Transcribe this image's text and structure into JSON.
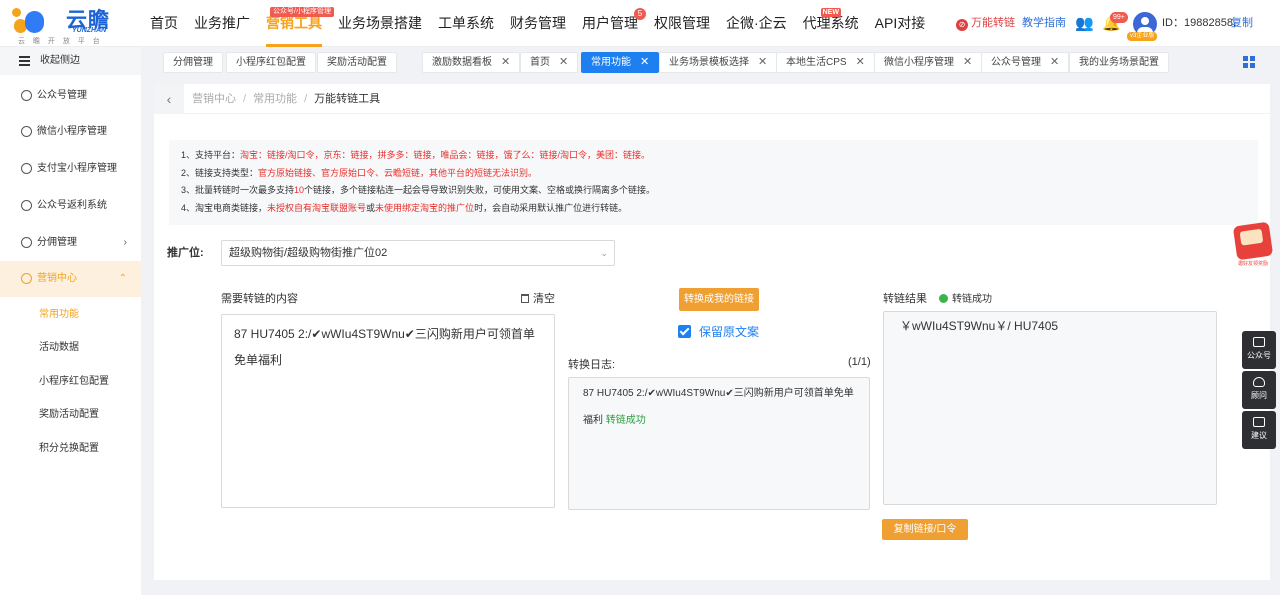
{
  "brand": {
    "name": "云瞻",
    "name_en": "YUNZHAN",
    "slogan": "云 瞻 开 放 平 台"
  },
  "nav": {
    "items": [
      {
        "label": "首页"
      },
      {
        "label": "业务推广"
      },
      {
        "label": "营销工具",
        "tag": "公众号/小程序管理",
        "active": true
      },
      {
        "label": "业务场景搭建"
      },
      {
        "label": "工单系统"
      },
      {
        "label": "财务管理"
      },
      {
        "label": "用户管理",
        "badge": "5"
      },
      {
        "label": "权限管理"
      },
      {
        "label": "企微·企云"
      },
      {
        "label": "代理系统",
        "new_tag": "NEW"
      },
      {
        "label": "API对接"
      }
    ]
  },
  "topright": {
    "shortlink_label": "万能转链",
    "guide_label": "教学指南",
    "bell_badge": "99+",
    "avatar_tag": "v3企业版",
    "id_text": "ID：19882858,",
    "copy_label": "复制"
  },
  "sidebar": {
    "collapse_label": "收起侧边",
    "items": [
      {
        "label": "公众号管理"
      },
      {
        "label": "微信小程序管理"
      },
      {
        "label": "支付宝小程序管理"
      },
      {
        "label": "公众号返利系统"
      },
      {
        "label": "分佣管理",
        "chevron": "›"
      },
      {
        "label": "营销中心",
        "chevron": "⌃",
        "active": true
      }
    ],
    "sub_items": [
      {
        "label": "常用功能",
        "active": true
      },
      {
        "label": "活动数据"
      },
      {
        "label": "小程序红包配置"
      },
      {
        "label": "奖励活动配置"
      },
      {
        "label": "积分兑换配置"
      }
    ]
  },
  "tabs": [
    {
      "label": "分佣管理",
      "closable": false
    },
    {
      "label": "小程序红包配置",
      "closable": false
    },
    {
      "label": "奖励活动配置",
      "closable": false
    },
    {
      "label": "激励数据看板",
      "closable": true
    },
    {
      "label": "首页",
      "closable": true
    },
    {
      "label": "常用功能",
      "closable": true,
      "active": true
    },
    {
      "label": "业务场景模板选择",
      "closable": true
    },
    {
      "label": "本地生活CPS",
      "closable": true
    },
    {
      "label": "微信小程序管理",
      "closable": true
    },
    {
      "label": "公众号管理",
      "closable": true
    },
    {
      "label": "我的业务场景配置",
      "closable": false
    }
  ],
  "breadcrumb": {
    "items": [
      "营销中心",
      "常用功能"
    ],
    "current": "万能转链工具",
    "sep": "/"
  },
  "tips": {
    "l1_prefix": "1、支持平台：",
    "l1_red": "淘宝：链接/淘口令，京东：链接，拼多多：链接，唯品会：链接，饿了么：链接/淘口令，美团：链接。",
    "l2_prefix": "2、链接支持类型：",
    "l2_red": "官方原始链接、官方原始口令、云瞻短链，其他平台的短链无法识别。",
    "l3_a": "3、批量转链时一次最多支持",
    "l3_num": "10",
    "l3_b": "个链接，多个链接粘连一起会导导致识别失败，可使用文案、空格或换行隔离多个链接。",
    "l4_a": "4、淘宝电商类链接，",
    "l4_red1": "未授权自有淘宝联盟账号",
    "l4_b": "或",
    "l4_red2": "未使用绑定淘宝的推广位",
    "l4_c": "时，会自动采用默认推广位进行转链。"
  },
  "form": {
    "position_label": "推广位:",
    "position_value": "超级购物街/超级购物街推广位02",
    "content_label": "需要转链的内容",
    "clear_label": "清空",
    "content_value": "87 HU7405  2:/✔wWIu4ST9Wnu✔三闪购新用户可领首单免单福利",
    "convert_label": "转换成我的链接",
    "keep_label": "保留原文案",
    "log_label": "转换日志:",
    "log_count": "(1/1)",
    "log_text": "87 HU7405 2:/✔wWIu4ST9Wnu✔三闪购新用户可领首单免单福利",
    "log_status": "转链成功",
    "result_label": "转链结果",
    "result_status": "转链成功",
    "result_value": "￥wWIu4ST9Wnu￥/ HU7405",
    "copy_label": "复制链接/口令"
  },
  "float": {
    "gift_caption": "邀好友领奖励",
    "tools": [
      "公众号",
      "顾问",
      "建议"
    ]
  }
}
